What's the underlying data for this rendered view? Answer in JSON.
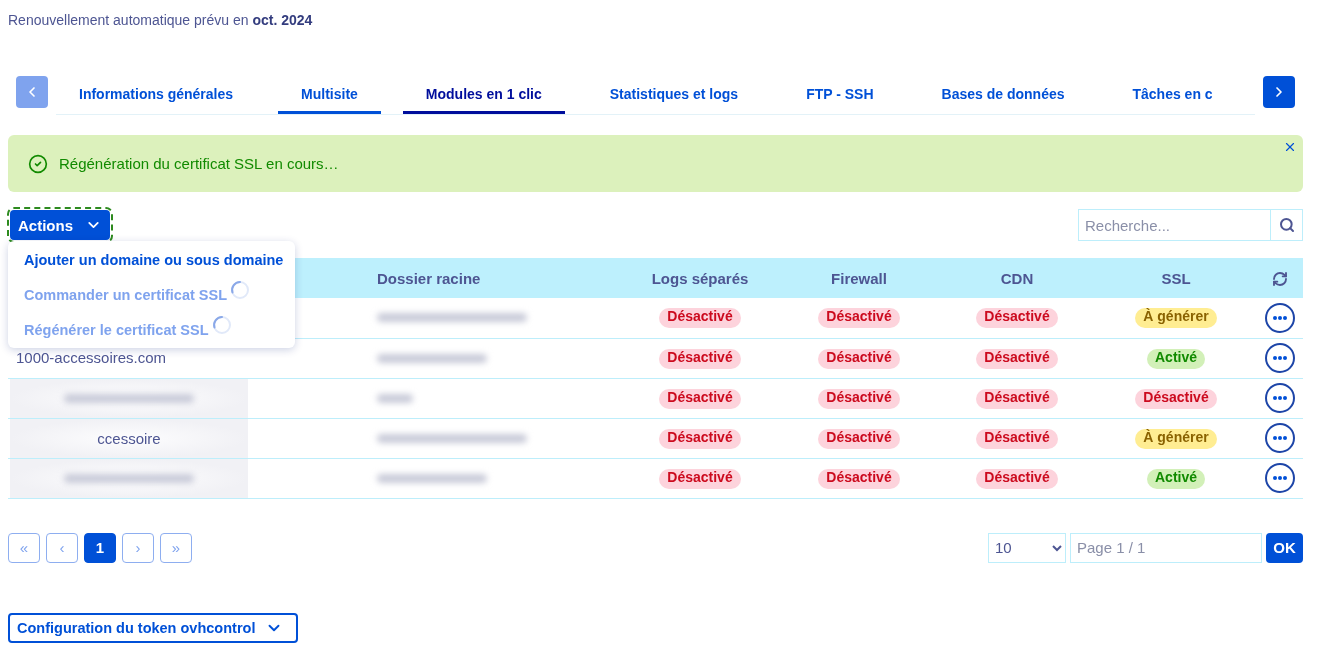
{
  "renewal": {
    "text": "Renouvellement automatique prévu en **oct. 2024**"
  },
  "tabs": {
    "prev": {
      "disabled": true
    },
    "next": {
      "disabled": false
    },
    "items": [
      {
        "label": "Informations générales",
        "selected": false,
        "hovered": false
      },
      {
        "label": "Multisite",
        "selected": false,
        "hovered": true
      },
      {
        "label": "Modules en 1 clic",
        "selected": true,
        "hovered": false
      },
      {
        "label": "Statistiques et logs",
        "selected": false,
        "hovered": false
      },
      {
        "label": "FTP - SSH",
        "selected": false,
        "hovered": false
      },
      {
        "label": "Bases de données",
        "selected": false,
        "hovered": false
      },
      {
        "label": "Tâches en c",
        "selected": false,
        "hovered": false
      }
    ]
  },
  "alert": {
    "message": "Régénération du certificat SSL en cours…"
  },
  "actions": {
    "label": "Actions",
    "focused": true,
    "open": true,
    "menu": [
      {
        "label": "Ajouter un domaine ou sous domaine",
        "disabled": false,
        "loading": false
      },
      {
        "label": "Commander un certificat SSL",
        "disabled": true,
        "loading": true
      },
      {
        "label": "Régénérer le certificat SSL",
        "disabled": true,
        "loading": true
      }
    ]
  },
  "search": {
    "placeholder": "Recherche..."
  },
  "table": {
    "columns": [
      {
        "label": "Dossier racine"
      },
      {
        "label": "Logs séparés"
      },
      {
        "label": "Firewall"
      },
      {
        "label": "CDN"
      },
      {
        "label": "SSL"
      }
    ],
    "rows": [
      {
        "domain_blurred": false,
        "root_folder_blurred": true,
        "statuses": [
          {
            "label": "Désactivé",
            "color": "#fdd3dc"
          },
          {
            "label": "Désactivé",
            "color": "#fdd3dc"
          },
          {
            "label": "Désactivé",
            "color": "#fdd3dc"
          },
          {
            "label": "À générer",
            "color": "#ffed92"
          }
        ]
      },
      {
        "domain": "1000-accessoires.com",
        "domain_blurred": false,
        "root_folder_blurred": true,
        "statuses": [
          {
            "label": "Désactivé",
            "color": "#fdd3dc"
          },
          {
            "label": "Désactivé",
            "color": "#fdd3dc"
          },
          {
            "label": "Désactivé",
            "color": "#fdd3dc"
          },
          {
            "label": "Activé",
            "color": "#d2f0b8"
          }
        ]
      },
      {
        "domain_blurred": true,
        "root_folder_blurred": true,
        "statuses": [
          {
            "label": "Désactivé",
            "color": "#fdd3dc"
          },
          {
            "label": "Désactivé",
            "color": "#fdd3dc"
          },
          {
            "label": "Désactivé",
            "color": "#fdd3dc"
          },
          {
            "label": "Désactivé",
            "color": "#fdd3dc"
          }
        ]
      },
      {
        "domain": "ccessoire",
        "domain_blurred": true,
        "root_folder_blurred": true,
        "statuses": [
          {
            "label": "Désactivé",
            "color": "#fdd3dc"
          },
          {
            "label": "Désactivé",
            "color": "#fdd3dc"
          },
          {
            "label": "Désactivé",
            "color": "#fdd3dc"
          },
          {
            "label": "À générer",
            "color": "#ffed92"
          }
        ]
      },
      {
        "domain_blurred": true,
        "root_folder_blurred": true,
        "statuses": [
          {
            "label": "Désactivé",
            "color": "#fdd3dc"
          },
          {
            "label": "Désactivé",
            "color": "#fdd3dc"
          },
          {
            "label": "Désactivé",
            "color": "#fdd3dc"
          },
          {
            "label": "Activé",
            "color": "#d2f0b8"
          }
        ]
      }
    ]
  },
  "pagination": {
    "buttons": [
      {
        "label": "«",
        "selected": false,
        "disabled": true
      },
      {
        "label": "‹",
        "selected": false,
        "disabled": true
      },
      {
        "label": "1",
        "selected": true,
        "disabled": false
      },
      {
        "label": "›",
        "selected": false,
        "disabled": true
      },
      {
        "label": "»",
        "selected": false,
        "disabled": true
      }
    ],
    "page_size": {
      "value": "10"
    },
    "page_input": {
      "placeholder": "Page 1 / 1"
    },
    "go_button": {
      "label": "OK"
    }
  },
  "token_config": {
    "label": "Configuration du token ovhcontrol"
  }
}
